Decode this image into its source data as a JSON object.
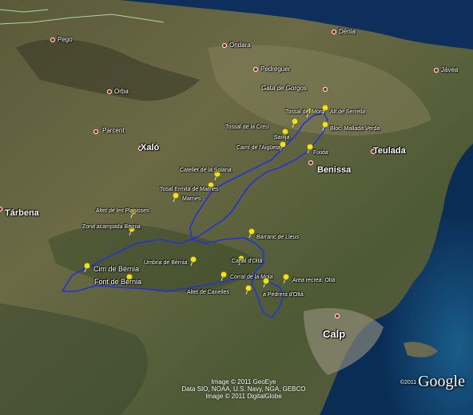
{
  "map": {
    "towns": [
      {
        "id": "pego",
        "name": "Pego",
        "size": "small"
      },
      {
        "id": "denia",
        "name": "Dènia",
        "size": "small"
      },
      {
        "id": "ondara",
        "name": "Ondara",
        "size": "small"
      },
      {
        "id": "pedreguer",
        "name": "Pedreguer",
        "size": "small"
      },
      {
        "id": "gata",
        "name": "Gata de Gorgos",
        "size": "small"
      },
      {
        "id": "javea",
        "name": "Jávea",
        "size": "small"
      },
      {
        "id": "orba",
        "name": "Orba",
        "size": "small"
      },
      {
        "id": "parcent",
        "name": "Parcent",
        "size": "small"
      },
      {
        "id": "xalo",
        "name": "Xaló",
        "size": "big"
      },
      {
        "id": "teulada",
        "name": "Teulada",
        "size": "big"
      },
      {
        "id": "benissa",
        "name": "Benissa",
        "size": "big"
      },
      {
        "id": "tarbena",
        "name": "Tárbena",
        "size": "big"
      },
      {
        "id": "calp",
        "name": "Calp",
        "size": "huge"
      }
    ],
    "waypoints": [
      {
        "id": "tossal-moro",
        "name": "Tossal del Moro"
      },
      {
        "id": "alt-serrella",
        "name": "Alt de Serrella"
      },
      {
        "id": "tossal-creu",
        "name": "Tossal de la Creu"
      },
      {
        "id": "bloc-mallada",
        "name": "Bloc. Mallada Verda"
      },
      {
        "id": "sanija",
        "name": "Sanija"
      },
      {
        "id": "cami-aigueta",
        "name": "Camí de l'Aigüeta"
      },
      {
        "id": "fixida",
        "name": "Fixida"
      },
      {
        "id": "catellet",
        "name": "Catellet de la Solana"
      },
      {
        "id": "tosal-ermita",
        "name": "Tosal Ermita de Marnes"
      },
      {
        "id": "marnes",
        "name": "Marnes"
      },
      {
        "id": "altet-planisses",
        "name": "Altet de les Planisses"
      },
      {
        "id": "zona-acampada",
        "name": "Zona acampada Bèrnia"
      },
      {
        "id": "barranc-lleus",
        "name": "Barranc de Lleus"
      },
      {
        "id": "cim-bernia",
        "name": "Cim de Bèrnia"
      },
      {
        "id": "umbria-bernia",
        "name": "Umbria de Bèrnia"
      },
      {
        "id": "canal-olta",
        "name": "Canal d'Oltà"
      },
      {
        "id": "font-bernia",
        "name": "Font de Bèrnia"
      },
      {
        "id": "corral-mola",
        "name": "Corral de la Mola"
      },
      {
        "id": "area-recrea",
        "name": "Area recrea. Oltà"
      },
      {
        "id": "altet-canelles",
        "name": "Altet de Canelles"
      },
      {
        "id": "pedrera-olta",
        "name": "a Pedrera d'Oltà"
      }
    ],
    "attribution": [
      "Image © 2011 GeoEye",
      "Data SIO, NOAA, U.S. Navy, NGA, GEBCO",
      "Image © 2011 DigitalGlobe"
    ],
    "logo": {
      "year": "©2011",
      "name": "Google"
    },
    "colors": {
      "route": "#2233dd",
      "pin": "#f5e11a",
      "town_dot": "#b01818",
      "sea": "#0d3a6a"
    }
  }
}
